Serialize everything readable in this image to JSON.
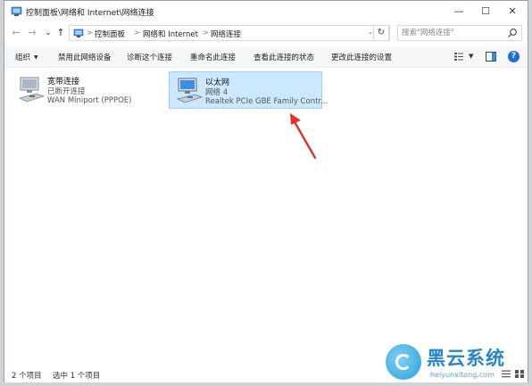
{
  "window": {
    "title": "控制面板\\网络和 Internet\\网络连接",
    "minimize": "—",
    "maximize": "☐",
    "close": "✕"
  },
  "nav": {
    "back": "←",
    "forward": "→",
    "recent": "⌄",
    "up": "↑"
  },
  "address": {
    "breadcrumbs": [
      "控制面板",
      "网络和 Internet",
      "网络连接"
    ],
    "separator": ">",
    "dropdown": "⌄",
    "refresh": "↻"
  },
  "search": {
    "placeholder": "搜索\"网络连接\""
  },
  "toolbar": {
    "organize": "组织",
    "disable": "禁用此网络设备",
    "diagnose": "诊断这个连接",
    "rename": "重命名此连接",
    "view_status": "查看此连接的状态",
    "change_settings": "更改此连接的设置",
    "help": "?",
    "dropdown": "▼"
  },
  "connections": [
    {
      "name": "宽带连接",
      "status": "已断开连接",
      "device": "WAN Miniport (PPPOE)",
      "icon": "broadband-connection-icon"
    },
    {
      "name": "以太网",
      "status": "网络 4",
      "device": "Realtek PCIe GBE Family Contr...",
      "icon": "ethernet-connection-icon",
      "selected": true
    }
  ],
  "statusbar": {
    "item_count": "2 个项目",
    "selected_count": "选中 1 个项目"
  },
  "watermark": {
    "title": "黑云系统",
    "url": "heiyunxitong.com"
  },
  "colors": {
    "selection_bg": "#cce8ff",
    "selection_border": "#99d1ff",
    "arrow": "#e0332b",
    "help": "#1f6fd6",
    "watermark": "#2a86c9"
  }
}
